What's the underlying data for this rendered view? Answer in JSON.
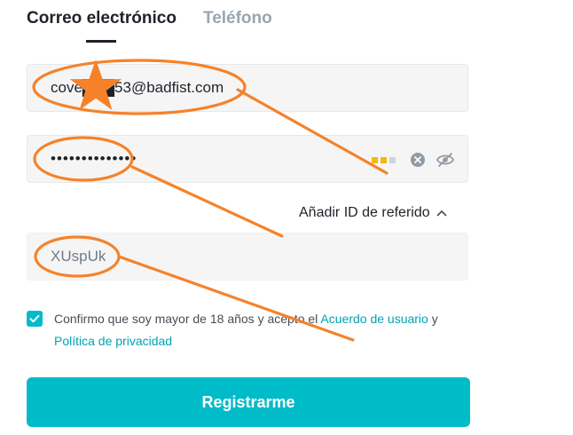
{
  "tabs": [
    {
      "label": "Correo electrónico",
      "active": true
    },
    {
      "label": "Teléfono",
      "active": false
    }
  ],
  "email": {
    "value": "cove███53@badfist.com"
  },
  "password": {
    "value": "••••••••••••••",
    "strength_colors": [
      "#f0b90b",
      "#f0b90b",
      "#d0d4d9"
    ]
  },
  "referral": {
    "toggle_label": "Añadir ID de referido",
    "value": "XUspUk"
  },
  "terms": {
    "checked": true,
    "text_before": "Confirmo que soy mayor de 18 años y acepto el ",
    "link1": "Acuerdo de usuario",
    "text_middle": " y ",
    "link2": "Política de privacidad"
  },
  "register": {
    "label": "Registrarme"
  },
  "colors": {
    "accent": "#00bcc9",
    "annotation": "#f58229"
  },
  "icons": {
    "clear": "clear-icon",
    "eye": "eye-off-icon",
    "chevron": "chevron-up-icon",
    "check": "check-icon"
  }
}
